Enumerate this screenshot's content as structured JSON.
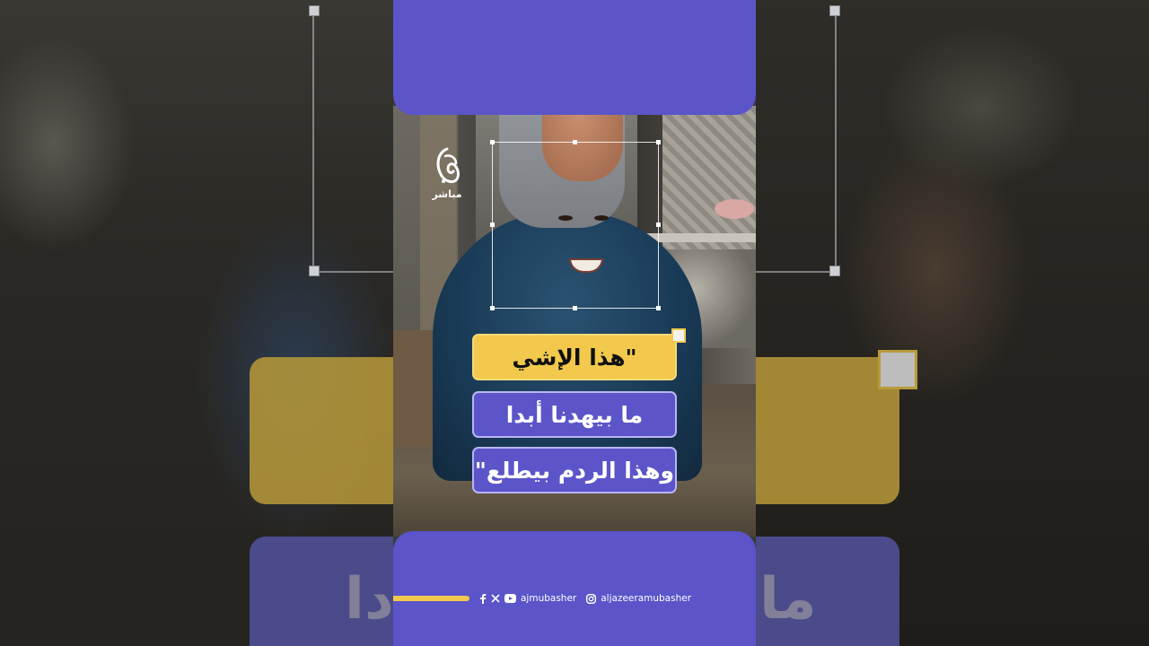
{
  "quote": {
    "line1": "\"هذا الإشي",
    "line2": "ما بيهدنا أبدا",
    "line3": "وهذا الردم بيطلع\""
  },
  "logo": {
    "subtitle": "مباشر"
  },
  "social": {
    "handle_primary": "ajmubasher",
    "handle_secondary": "aljazeeramubasher",
    "icons": [
      "facebook-icon",
      "x-icon",
      "youtube-icon",
      "instagram-icon"
    ]
  },
  "background": {
    "big_text_left": "دا",
    "big_text_right": "ما"
  },
  "colors": {
    "band_purple": "#5b55c9",
    "accent_yellow": "#f2c94c",
    "box_border": "#b9b5f3"
  },
  "progress": {
    "fraction": 0.21
  }
}
